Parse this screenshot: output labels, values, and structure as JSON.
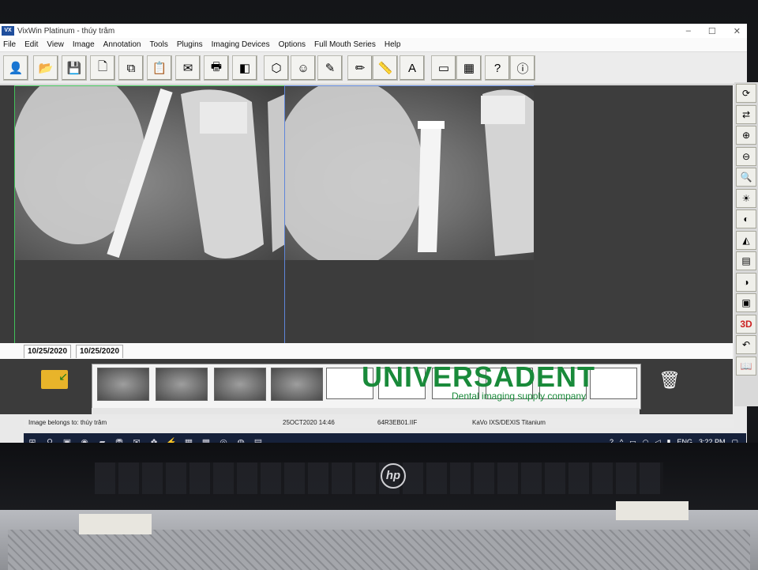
{
  "window": {
    "app_badge": "VX",
    "title": "VixWin Platinum - thúy trâm",
    "controls": [
      "–",
      "☐",
      "✕"
    ]
  },
  "menu": [
    "File",
    "Edit",
    "View",
    "Image",
    "Annotation",
    "Tools",
    "Plugins",
    "Imaging Devices",
    "Options",
    "Full Mouth Series",
    "Help"
  ],
  "toolbar_icons": [
    "patient-icon",
    "open-folder-icon",
    "save-icon",
    "new-document-icon",
    "copy-icon",
    "paste-icon",
    "export-icon",
    "print-icon",
    "eraser-icon",
    "3d-cube-icon",
    "face-photo-icon",
    "pen-icon",
    "pencil-icon",
    "ruler-icon",
    "text-icon",
    "window-layout-icon",
    "grid-layout-icon",
    "help-icon",
    "info-icon"
  ],
  "side_tools": [
    "rotate-icon",
    "flip-icon",
    "zoom-in-icon",
    "zoom-out-icon",
    "magnify-icon",
    "brightness-icon",
    "contrast-icon",
    "sharpen-icon",
    "filter-icon",
    "invert-icon",
    "emboss-icon",
    "3d-icon",
    "undo-icon",
    "book-icon"
  ],
  "date_tabs": [
    "10/25/2020",
    "10/25/2020"
  ],
  "status": {
    "owner": "Image belongs to:  thúy trâm",
    "datetime": "25OCT2020 14:46",
    "filename": "64R3EB01.IIF",
    "device": "KaVo IXS/DEXIS Titanium"
  },
  "taskbar": {
    "lang": "ENG",
    "time": "3:22 PM"
  },
  "watermark": {
    "brand": "UNIVERSADENT",
    "tagline": "Dental imaging supply company"
  },
  "laptop_brand": "hp",
  "colors": {
    "left_frame": "#42c25a",
    "right_frame": "#5f86d9",
    "watermark": "#198a3a"
  }
}
